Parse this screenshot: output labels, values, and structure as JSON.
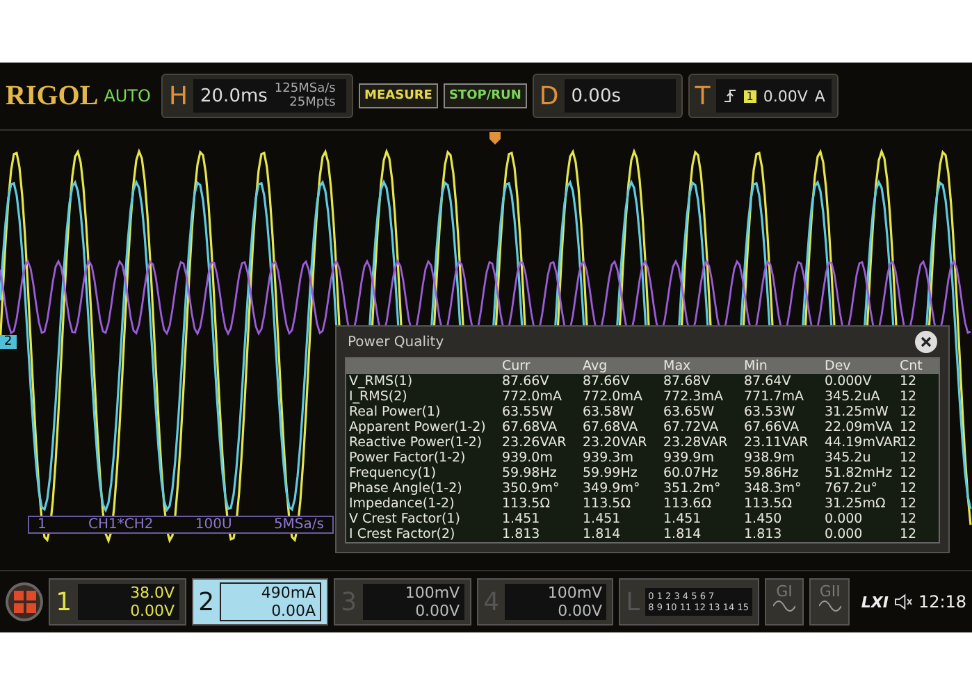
{
  "top_bar": {
    "logo": "RIGOL",
    "mode": "AUTO",
    "horizontal": {
      "label": "H",
      "timebase": "20.0ms",
      "sample_rate": "125MSa/s",
      "memory_depth": "25Mpts"
    },
    "buttons": [
      {
        "label": "MEASURE"
      },
      {
        "label": "STOP/RUN"
      }
    ],
    "delay": {
      "label": "D",
      "value": "0.00s"
    },
    "trigger": {
      "label": "T",
      "source_badge": "1",
      "level": "0.00V",
      "coupling": "A"
    }
  },
  "waveform": {
    "channel_marker": "2",
    "math_label": {
      "source": "1",
      "expression": "CH1*CH2",
      "scale": "100U",
      "rate": "5MSa/s"
    }
  },
  "dialog": {
    "title": "Power Quality",
    "columns": [
      "",
      "Curr",
      "Avg",
      "Max",
      "Min",
      "Dev",
      "Cnt"
    ],
    "rows": [
      [
        "V_RMS(1)",
        "87.66V",
        "87.66V",
        "87.68V",
        "87.64V",
        "0.000V",
        "12"
      ],
      [
        "I_RMS(2)",
        "772.0mA",
        "772.0mA",
        "772.3mA",
        "771.7mA",
        "345.2uA",
        "12"
      ],
      [
        "Real Power(1)",
        "63.55W",
        "63.58W",
        "63.65W",
        "63.53W",
        "31.25mW",
        "12"
      ],
      [
        "Apparent Power(1-2)",
        "67.68VA",
        "67.68VA",
        "67.72VA",
        "67.66VA",
        "22.09mVA",
        "12"
      ],
      [
        "Reactive Power(1-2)",
        "23.26VAR",
        "23.20VAR",
        "23.28VAR",
        "23.11VAR",
        "44.19mVAR",
        "12"
      ],
      [
        "Power Factor(1-2)",
        "939.0m",
        "939.3m",
        "939.9m",
        "938.9m",
        "345.2u",
        "12"
      ],
      [
        "Frequency(1)",
        "59.98Hz",
        "59.99Hz",
        "60.07Hz",
        "59.86Hz",
        "51.82mHz",
        "12"
      ],
      [
        "Phase Angle(1-2)",
        "350.9m°",
        "349.9m°",
        "351.2m°",
        "348.3m°",
        "767.2u°",
        "12"
      ],
      [
        "Impedance(1-2)",
        "113.5Ω",
        "113.5Ω",
        "113.6Ω",
        "113.5Ω",
        "31.25mΩ",
        "12"
      ],
      [
        "V Crest Factor(1)",
        "1.451",
        "1.451",
        "1.451",
        "1.450",
        "0.000",
        "12"
      ],
      [
        "I Crest Factor(2)",
        "1.813",
        "1.814",
        "1.814",
        "1.813",
        "0.000",
        "12"
      ]
    ]
  },
  "bottom_bar": {
    "channels": [
      {
        "number": "1",
        "scale": "38.0V",
        "offset": "0.00V",
        "on": true,
        "selected": false,
        "color": "#e2e24c"
      },
      {
        "number": "2",
        "scale": "490mA",
        "offset": "0.00A",
        "on": true,
        "selected": true,
        "color": "#a8dcec"
      },
      {
        "number": "3",
        "scale": "100mV",
        "offset": "0.00V",
        "on": false,
        "selected": false
      },
      {
        "number": "4",
        "scale": "100mV",
        "offset": "0.00V",
        "on": false,
        "selected": false
      }
    ],
    "logic": {
      "label": "L",
      "bits_top": "0 1 2 3  4 5 6 7",
      "bits_bottom": "8 9 10 11 12 13 14 15"
    },
    "generators": [
      "GI",
      "GII"
    ],
    "lxi": "LXI",
    "time": "12:18"
  }
}
